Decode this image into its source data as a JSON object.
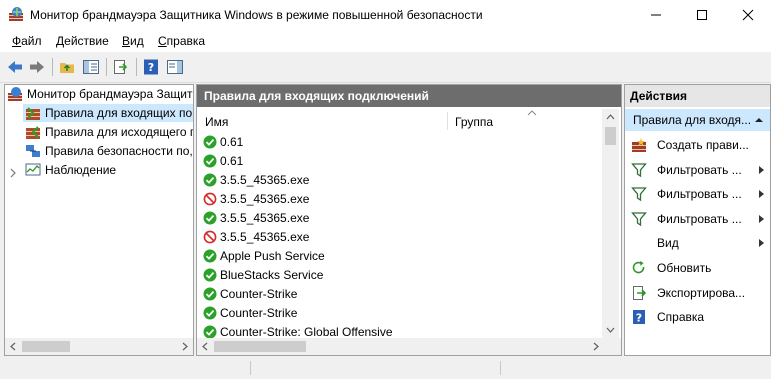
{
  "window": {
    "title": "Монитор брандмауэра Защитника Windows в режиме повышенной безопасности"
  },
  "menu": {
    "items": [
      {
        "underline": "Ф",
        "rest": "айл"
      },
      {
        "underline": "Д",
        "rest": "ействие"
      },
      {
        "underline": "В",
        "rest": "ид"
      },
      {
        "underline": "С",
        "rest": "правка"
      }
    ]
  },
  "tree": {
    "root": "Монитор брандмауэра Защитн",
    "items": [
      "Правила для входящих по",
      "Правила для исходящего п",
      "Правила безопасности по,",
      "Наблюдение"
    ]
  },
  "center": {
    "title": "Правила для входящих подключений",
    "columns": {
      "name": "Имя",
      "group": "Группа"
    },
    "rules": [
      {
        "name": "0.61",
        "status": "allow"
      },
      {
        "name": "0.61",
        "status": "allow"
      },
      {
        "name": "3.5.5_45365.exe",
        "status": "allow"
      },
      {
        "name": "3.5.5_45365.exe",
        "status": "block"
      },
      {
        "name": "3.5.5_45365.exe",
        "status": "allow"
      },
      {
        "name": "3.5.5_45365.exe",
        "status": "block"
      },
      {
        "name": "Apple Push Service",
        "status": "allow"
      },
      {
        "name": "BlueStacks Service",
        "status": "allow"
      },
      {
        "name": "Counter-Strike",
        "status": "allow"
      },
      {
        "name": "Counter-Strike",
        "status": "allow"
      },
      {
        "name": "Counter-Strike: Global Offensive",
        "status": "allow"
      }
    ]
  },
  "actions": {
    "header": "Действия",
    "section": "Правила для входя...",
    "items": [
      {
        "label": "Создать прави...",
        "icon": "new-rule-icon",
        "submenu": false
      },
      {
        "label": "Фильтровать ...",
        "icon": "filter-icon",
        "submenu": true
      },
      {
        "label": "Фильтровать ...",
        "icon": "filter-icon",
        "submenu": true
      },
      {
        "label": "Фильтровать ...",
        "icon": "filter-icon",
        "submenu": true
      },
      {
        "label": "Вид",
        "icon": "",
        "submenu": true
      },
      {
        "label": "Обновить",
        "icon": "refresh-icon",
        "submenu": false
      },
      {
        "label": "Экспортирова...",
        "icon": "export-icon",
        "submenu": false
      },
      {
        "label": "Справка",
        "icon": "help-icon",
        "submenu": false
      }
    ]
  },
  "colors": {
    "allow": "#2aa22a",
    "block": "#d42a2a",
    "header_dark": "#6d6d6d",
    "selection": "#cce8ff"
  }
}
